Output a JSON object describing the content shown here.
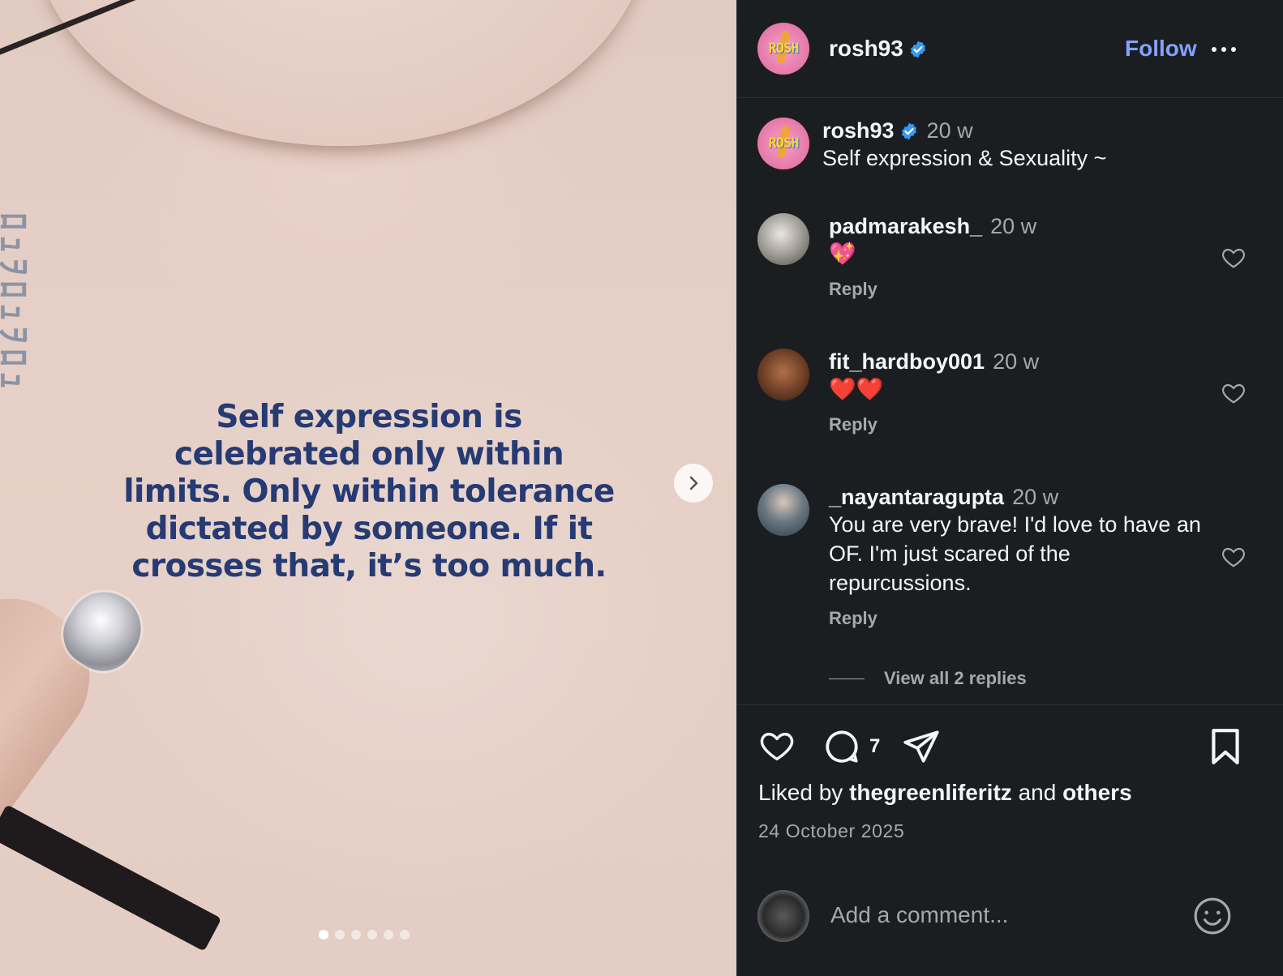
{
  "media": {
    "quote": "Self expression is celebrated only within limits. Only within tolerance dictated by someone. If it crosses that, it’s too much.",
    "slide_count": 6,
    "active_slide": 1,
    "next_icon": "chevron-right-icon"
  },
  "header": {
    "avatar_logo": "ROSH",
    "username": "rosh93",
    "follow_label": "Follow",
    "more_icon": "more-horizontal-icon"
  },
  "caption": {
    "username": "rosh93",
    "time": "20 w",
    "text": "Self expression & Sexuality ~"
  },
  "comments": [
    {
      "username": "padmarakesh_",
      "time": "20 w",
      "text": "💖",
      "reply_label": "Reply"
    },
    {
      "username": "fit_hardboy001",
      "time": "20 w",
      "text": "❤️❤️",
      "reply_label": "Reply"
    },
    {
      "username": "_nayantaragupta",
      "time": "20 w",
      "text": "You are very brave! I'd love to have an OF. I'm just scared of the repurcussions.",
      "reply_label": "Reply",
      "view_replies_label": "View all 2 replies"
    }
  ],
  "actions": {
    "comment_count": "7",
    "liked_prefix": "Liked by",
    "liked_user": "thegreenliferitz",
    "liked_and": "and",
    "liked_others": "others",
    "date": "24 October 2025"
  },
  "composer": {
    "placeholder": "Add a comment..."
  },
  "colors": {
    "background": "#1b1e21",
    "follow": "#85a1ff",
    "verified": "#3897f0",
    "quote_text": "#263a73"
  }
}
